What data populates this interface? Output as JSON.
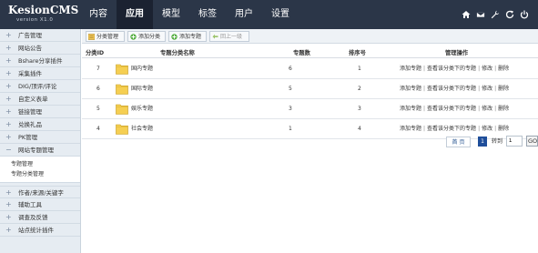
{
  "app": {
    "name": "KesionCMS",
    "version": "version X1.0"
  },
  "nav": {
    "tabs": [
      "内容",
      "应用",
      "模型",
      "标签",
      "用户",
      "设置"
    ],
    "active": "应用"
  },
  "top_icons": [
    "home-icon",
    "mail-icon",
    "wrench-icon",
    "refresh-icon",
    "power-icon"
  ],
  "sidebar": {
    "items_top": [
      "广告管理",
      "网站公告",
      "Bshare分享插件",
      "采集插件",
      "DIG/顶评/评论",
      "自定义表单",
      "链接管理",
      "兑换礼品",
      "PK管理",
      "网站专题管理"
    ],
    "subitems": [
      "专题管理",
      "专题分类管理"
    ],
    "items_bottom": [
      "作者/来源/关键字",
      "辅助工具",
      "调查及反馈",
      "站点统计插件"
    ]
  },
  "toolbar": {
    "btn1": "分类管理",
    "btn2": "添加分类",
    "btn3": "添加专题",
    "btn4": "回上一级"
  },
  "table": {
    "headers": {
      "id": "分类ID",
      "name": "专题分类名称",
      "count": "专题数",
      "order": "排序号",
      "ops": "管理操作"
    },
    "rows": [
      {
        "id": "7",
        "name": "国内专题",
        "count": "6",
        "order": "1"
      },
      {
        "id": "6",
        "name": "国际专题",
        "count": "5",
        "order": "2"
      },
      {
        "id": "5",
        "name": "娱乐专题",
        "count": "3",
        "order": "3"
      },
      {
        "id": "4",
        "name": "社会专题",
        "count": "1",
        "order": "4"
      }
    ],
    "ops": {
      "add": "添加专题",
      "view": "查看该分类下的专题",
      "edit": "修改",
      "delete": "删除",
      "sep": "|"
    }
  },
  "pager": {
    "first": "首 页",
    "current": "1",
    "goto_label": "转到",
    "goto_value": "1",
    "go": "GO"
  },
  "colors": {
    "topbar": "#2b3648",
    "active_tab": "#1b2231",
    "sidebar": "#e6ecf2",
    "accent": "#1f4e9a"
  }
}
